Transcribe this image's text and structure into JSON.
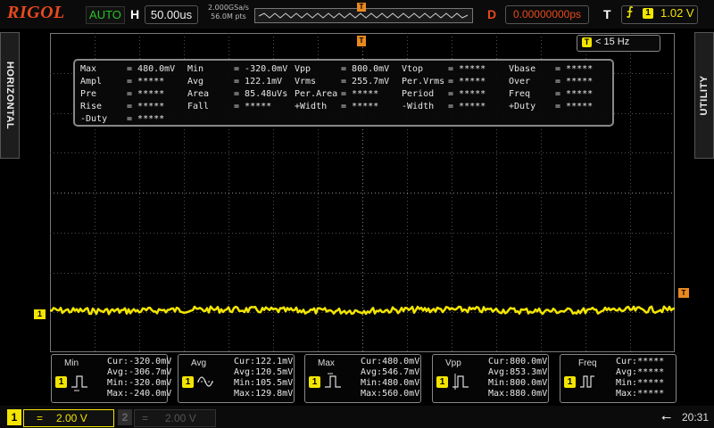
{
  "header": {
    "brand": "RIGOL",
    "run_status": "AUTO",
    "horizontal_label": "H",
    "timebase": "50.00us",
    "sample_rate": "2.000GSa/s",
    "memory_depth": "56.0M pts",
    "delay_label": "D",
    "trigger_position": "0.00000000ps",
    "trigger_label": "T",
    "trigger_source": "1",
    "trigger_level": "1.02 V",
    "trigger_marker": "T"
  },
  "side_tabs": {
    "left": "HORIZONTAL",
    "right": "UTILITY"
  },
  "filter": {
    "source": "T",
    "text": "< 15 Hz"
  },
  "markers": {
    "ch1_ground": "1",
    "trigger_level": "T"
  },
  "measurements": [
    [
      {
        "name": "Max",
        "value": "480.0mV"
      },
      {
        "name": "Min",
        "value": "-320.0mV"
      },
      {
        "name": "Vpp",
        "value": "800.0mV"
      },
      {
        "name": "Vtop",
        "value": "*****"
      },
      {
        "name": "Vbase",
        "value": "*****"
      }
    ],
    [
      {
        "name": "Ampl",
        "value": "*****"
      },
      {
        "name": "Avg",
        "value": "122.1mV"
      },
      {
        "name": "Vrms",
        "value": "255.7mV"
      },
      {
        "name": "Per.Vrms",
        "value": "*****"
      },
      {
        "name": "Over",
        "value": "*****"
      }
    ],
    [
      {
        "name": "Pre",
        "value": "*****"
      },
      {
        "name": "Area",
        "value": "85.48uVs"
      },
      {
        "name": "Per.Area",
        "value": "*****"
      },
      {
        "name": "Period",
        "value": "*****"
      },
      {
        "name": "Freq",
        "value": "*****"
      }
    ],
    [
      {
        "name": "Rise",
        "value": "*****"
      },
      {
        "name": "Fall",
        "value": "*****"
      },
      {
        "name": "+Width",
        "value": "*****"
      },
      {
        "name": "-Width",
        "value": "*****"
      },
      {
        "name": "+Duty",
        "value": "*****"
      }
    ],
    [
      {
        "name": "-Duty",
        "value": "*****"
      }
    ]
  ],
  "stats": [
    {
      "name": "Min",
      "channel": "1",
      "cur": "Cur:-320.0mV",
      "avg": "Avg:-306.7mV",
      "min": "Min:-320.0mV",
      "max": "Max:-240.0mV"
    },
    {
      "name": "Avg",
      "channel": "1",
      "cur": "Cur:122.1mV",
      "avg": "Avg:120.5mV",
      "min": "Min:105.5mV",
      "max": "Max:129.8mV"
    },
    {
      "name": "Max",
      "channel": "1",
      "cur": "Cur:480.0mV",
      "avg": "Avg:546.7mV",
      "min": "Min:480.0mV",
      "max": "Max:560.0mV"
    },
    {
      "name": "Vpp",
      "channel": "1",
      "cur": "Cur:800.0mV",
      "avg": "Avg:853.3mV",
      "min": "Min:800.0mV",
      "max": "Max:880.0mV"
    },
    {
      "name": "Freq",
      "channel": "1",
      "cur": "Cur:*****",
      "avg": "Avg:*****",
      "min": "Min:*****",
      "max": "Max:*****"
    }
  ],
  "channels": [
    {
      "number": "1",
      "coupling_symbol": "=",
      "scale": "2.00 V",
      "active": true
    },
    {
      "number": "2",
      "coupling_symbol": "=",
      "scale": "2.00 V",
      "active": false
    }
  ],
  "status": {
    "clock": "20:31",
    "usb_icon": "usb-icon"
  },
  "colors": {
    "ch1": "#f3e500",
    "trigger": "#e8891d",
    "brand": "#e8491d",
    "run": "#27c227"
  }
}
